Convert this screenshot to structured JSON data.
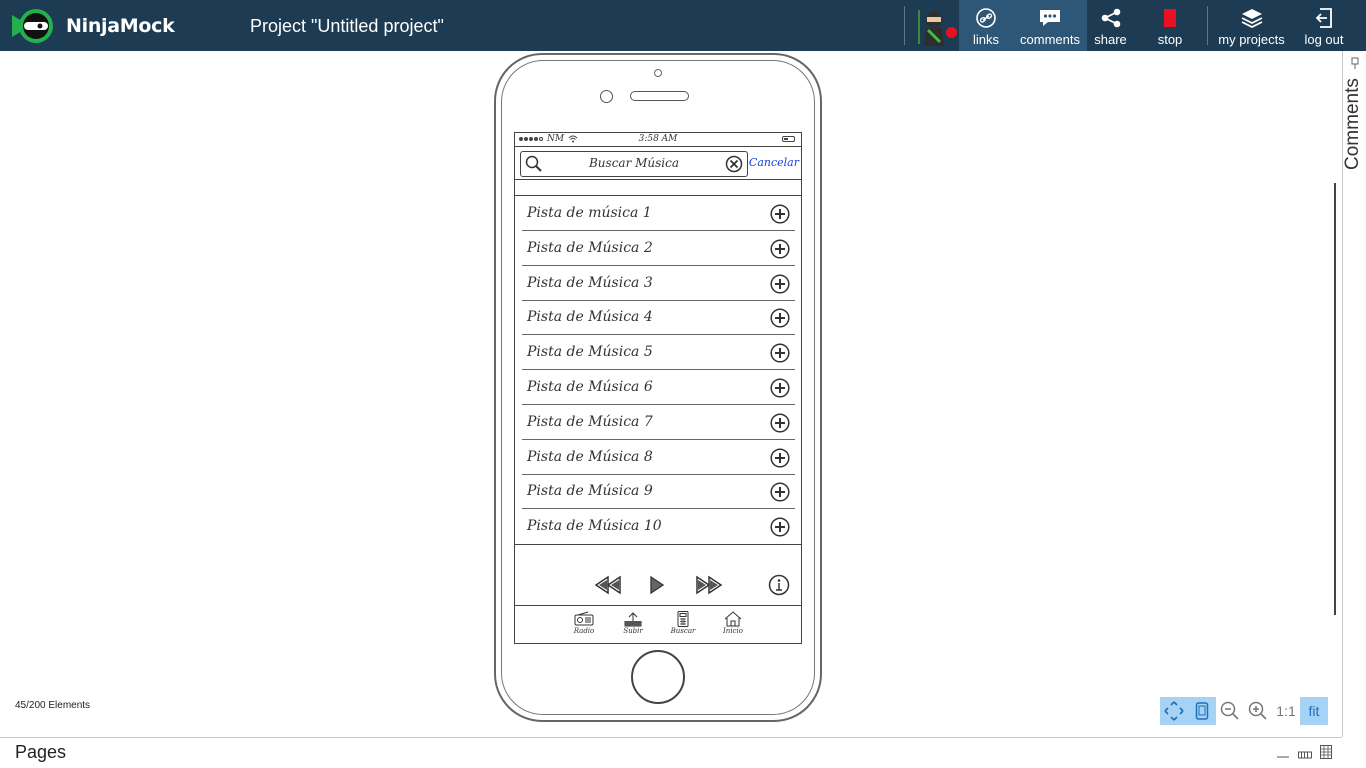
{
  "app": {
    "logo_text": "NinjaMock",
    "project_title": "Project \"Untitled project\""
  },
  "toolbar": {
    "links_label": "links",
    "comments_label": "comments",
    "share_label": "share",
    "stop_label": "stop",
    "my_projects_label": "my projects",
    "log_out_label": "log out"
  },
  "colors": {
    "topbar": "#1d3c54",
    "active_button": "#2e5676",
    "status_dot": "#e81123",
    "stop_icon": "#e81123",
    "zoom_active": "#a6d3f5",
    "link_blue": "#1a3fd8"
  },
  "side_panel": {
    "comments_label": "Comments"
  },
  "canvas": {
    "element_count": "45/200 Elements",
    "zoom_controls": {
      "one_to_one": "1:1",
      "fit": "fit"
    },
    "pages_label": "Pages"
  },
  "mock": {
    "status": {
      "carrier": "NM",
      "time": "3:58 AM"
    },
    "search": {
      "placeholder": "Buscar Música",
      "cancel": "Cancelar"
    },
    "tracks": [
      "Pista de música 1",
      "Pista de Música 2",
      "Pista de Música 3",
      "Pista de Música 4",
      "Pista de Música 5",
      "Pista de Música 6",
      "Pista de Música 7",
      "Pista de Música 8",
      "Pista de Música 9",
      "Pista de Música 10"
    ],
    "tabs": [
      {
        "label": "Radio",
        "icon": "radio-icon"
      },
      {
        "label": "Subir",
        "icon": "upload-icon"
      },
      {
        "label": "Buscar",
        "icon": "calculator-icon"
      },
      {
        "label": "Inicio",
        "icon": "home-icon"
      }
    ]
  }
}
